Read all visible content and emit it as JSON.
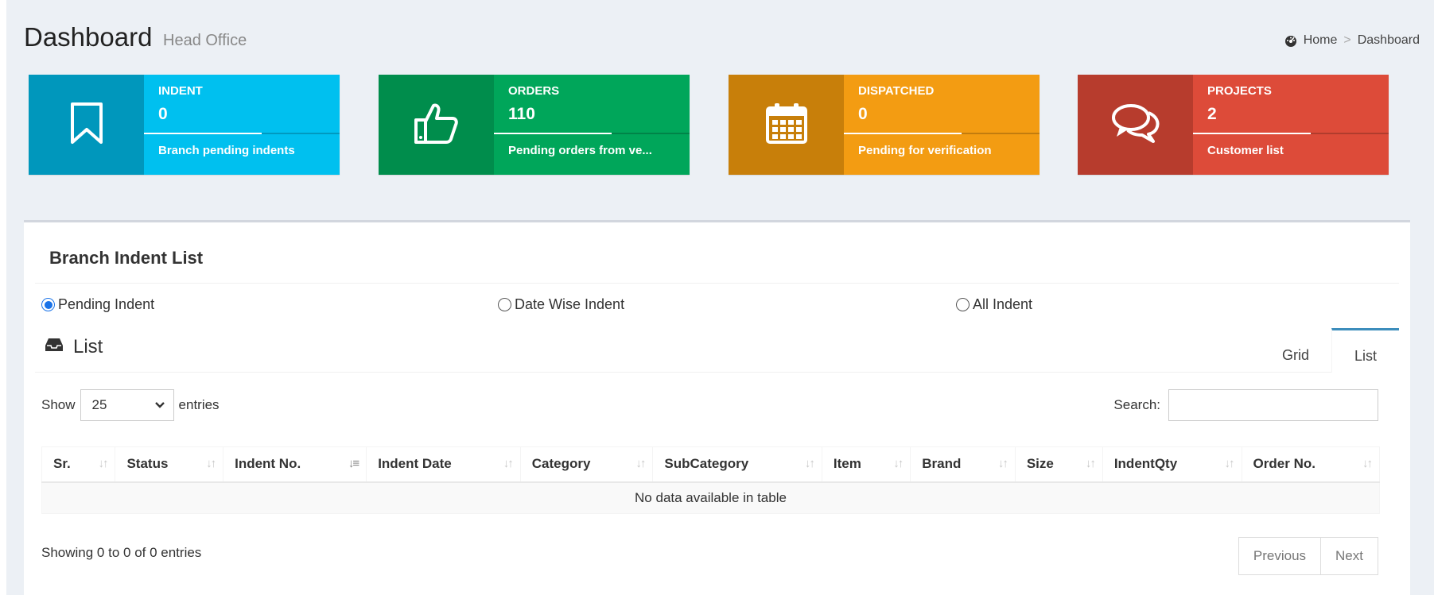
{
  "header": {
    "title": "Dashboard",
    "subtitle": "Head Office",
    "breadcrumb": {
      "home": "Home",
      "separator": ">",
      "current": "Dashboard"
    }
  },
  "info_boxes": [
    {
      "label": "INDENT",
      "number": "0",
      "description": "Branch pending indents",
      "icon": "bookmark-icon",
      "color": "#00c0ef",
      "progress": 0.6
    },
    {
      "label": "ORDERS",
      "number": "110",
      "description": "Pending orders from ve...",
      "icon": "thumbs-up-icon",
      "color": "#00a65a",
      "progress": 0.6
    },
    {
      "label": "DISPATCHED",
      "number": "0",
      "description": "Pending for verification",
      "icon": "calendar-icon",
      "color": "#f39c12",
      "progress": 0.6
    },
    {
      "label": "PROJECTS",
      "number": "2",
      "description": "Customer list",
      "icon": "comments-icon",
      "color": "#dd4b39",
      "progress": 0.6
    }
  ],
  "main": {
    "title": "Branch Indent List",
    "radios": [
      {
        "label": "Pending Indent",
        "checked": true
      },
      {
        "label": "Date Wise Indent",
        "checked": false
      },
      {
        "label": "All Indent",
        "checked": false
      }
    ],
    "list_title": "List",
    "tabs": [
      {
        "label": "Grid",
        "active": false
      },
      {
        "label": "List",
        "active": true
      }
    ],
    "show_label": "Show",
    "entries_value": "25",
    "entries_label": "entries",
    "search_label": "Search:",
    "search_value": "",
    "columns": [
      "Sr.",
      "Status",
      "Indent No.",
      "Indent Date",
      "Category",
      "SubCategory",
      "Item",
      "Brand",
      "Size",
      "IndentQty",
      "Order No."
    ],
    "empty_message": "No data available in table",
    "info_text": "Showing 0 to 0 of 0 entries",
    "pager": {
      "previous": "Previous",
      "next": "Next"
    }
  }
}
